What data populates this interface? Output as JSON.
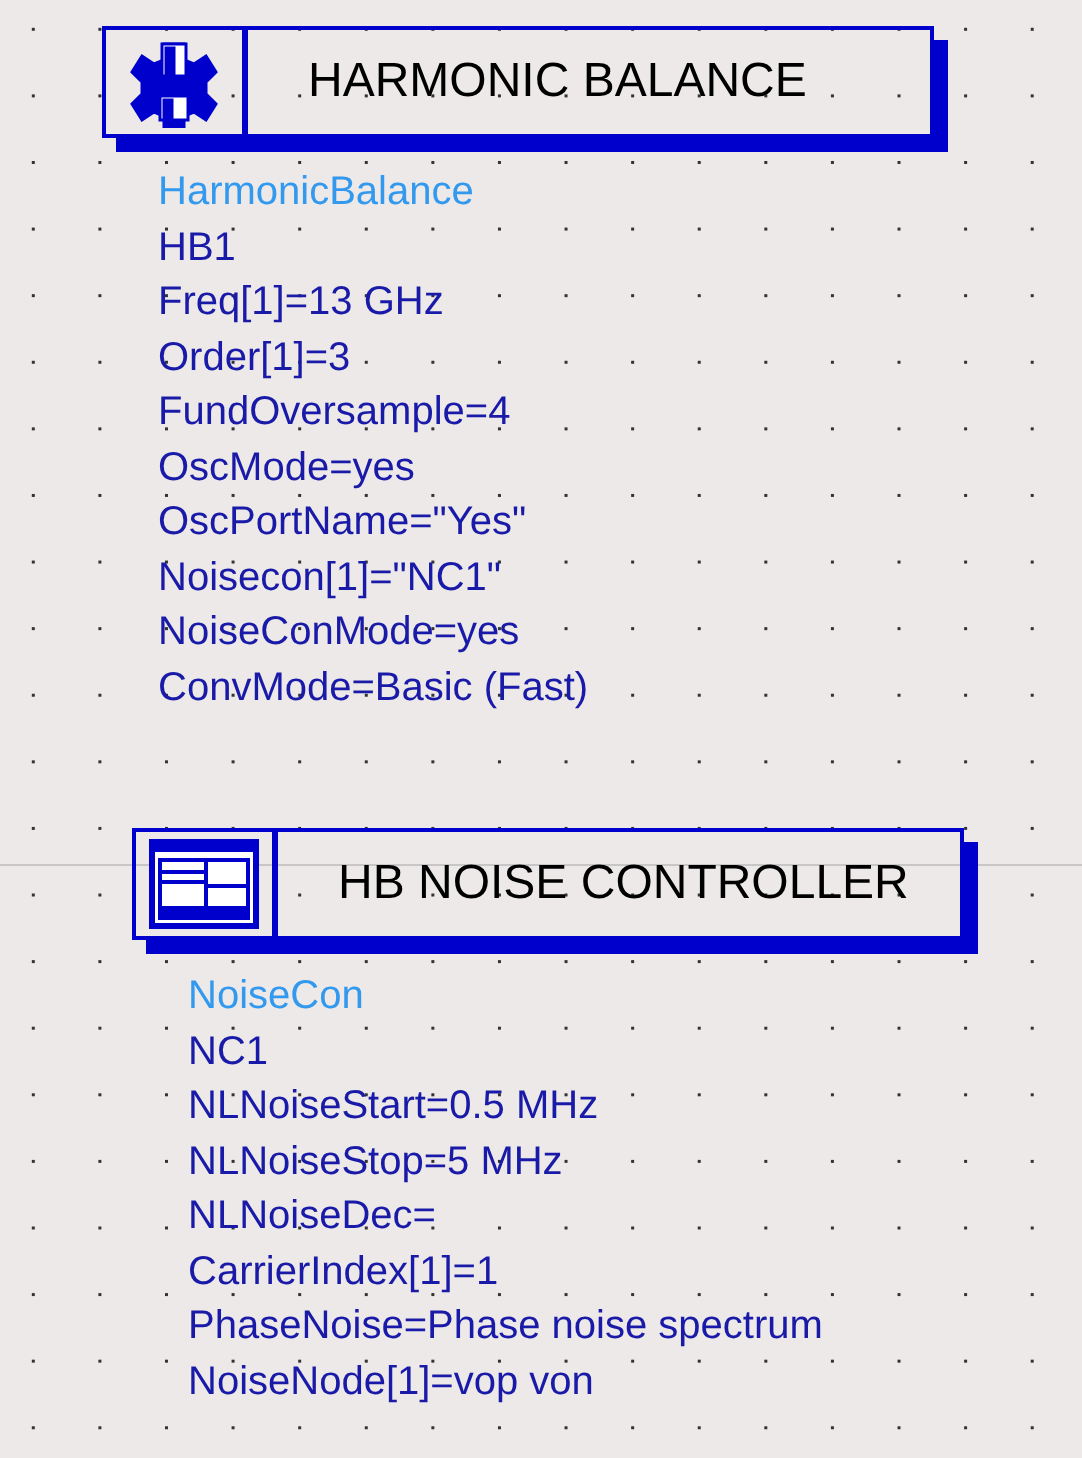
{
  "components": [
    {
      "kind": "harmonic-balance",
      "title": "HARMONIC BALANCE",
      "type_name": "HarmonicBalance",
      "instance": "HB1",
      "parameters": [
        "Freq[1]=13 GHz",
        "Order[1]=3",
        "FundOversample=4",
        "OscMode=yes",
        "OscPortName=\"Yes\"",
        "Noisecon[1]=\"NC1\"",
        "NoiseConMode=yes",
        "ConvMode=Basic (Fast)"
      ]
    },
    {
      "kind": "noise-controller",
      "title": "HB NOISE CONTROLLER",
      "type_name": "NoiseCon",
      "instance": "NC1",
      "parameters": [
        "NLNoiseStart=0.5 MHz",
        "NLNoiseStop=5 MHz",
        "NLNoiseDec=",
        "CarrierIndex[1]=1",
        "PhaseNoise=Phase noise spectrum",
        "NoiseNode[1]=vop von"
      ]
    }
  ]
}
